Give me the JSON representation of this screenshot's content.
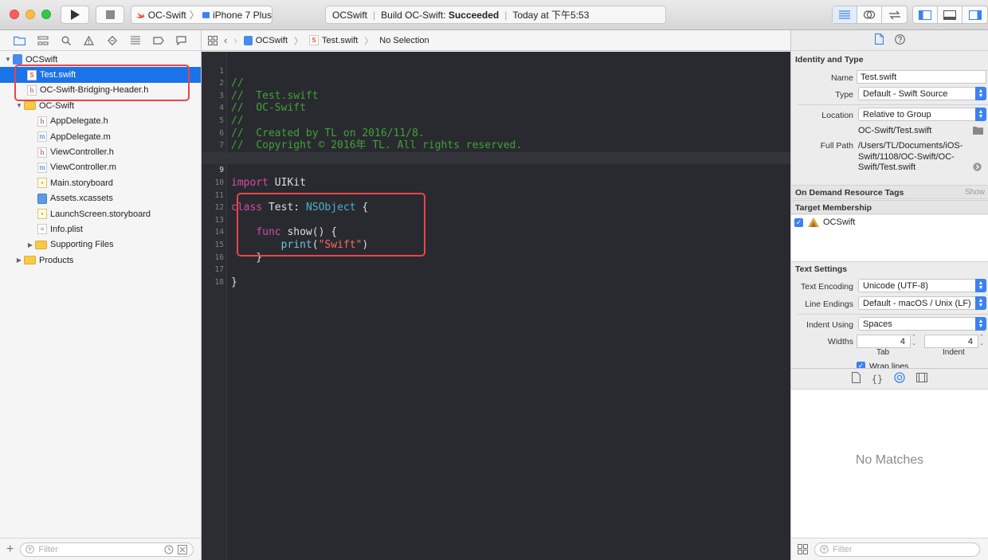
{
  "toolbar": {
    "scheme_target": "OC-Swift",
    "scheme_device": "iPhone 7 Plus",
    "activity_project": "OCSwift",
    "activity_build_prefix": "Build OC-Swift: ",
    "activity_build_status": "Succeeded",
    "activity_time": "Today at 下午5:53"
  },
  "navigator": {
    "items": [
      {
        "label": "OCSwift"
      },
      {
        "label": "Test.swift"
      },
      {
        "label": "OC-Swift-Bridging-Header.h"
      },
      {
        "label": "OC-Swift"
      },
      {
        "label": "AppDelegate.h"
      },
      {
        "label": "AppDelegate.m"
      },
      {
        "label": "ViewController.h"
      },
      {
        "label": "ViewController.m"
      },
      {
        "label": "Main.storyboard"
      },
      {
        "label": "Assets.xcassets"
      },
      {
        "label": "LaunchScreen.storyboard"
      },
      {
        "label": "Info.plist"
      },
      {
        "label": "Supporting Files"
      },
      {
        "label": "Products"
      }
    ],
    "filter_placeholder": "Filter"
  },
  "jumpbar": {
    "project": "OCSwift",
    "file": "Test.swift",
    "selection": "No Selection"
  },
  "editor": {
    "line_numbers": [
      "1",
      "2",
      "3",
      "4",
      "5",
      "6",
      "7",
      "8",
      "9",
      "10",
      "11",
      "12",
      "13",
      "14",
      "15",
      "16",
      "17",
      "18"
    ],
    "current_line": 9,
    "code": {
      "l1": "//",
      "l2": "//  Test.swift",
      "l3": "//  OC-Swift",
      "l4": "//",
      "l5": "//  Created by TL on 2016/11/8.",
      "l6": "//  Copyright © 2016年 TL. All rights reserved.",
      "l7": "//",
      "kw_import": "import",
      "mod_uikit": " UIKit",
      "kw_class": "class",
      "class_name": " Test: ",
      "superclass": "NSObject",
      "brace_open": " {",
      "indent1": "    ",
      "kw_func": "func",
      "func_sig": " show() {",
      "indent2": "        ",
      "fn_print": "print",
      "paren_open": "(",
      "str_swift": "\"Swift\"",
      "paren_close": ")",
      "close_func": "    }",
      "close_class": "}"
    }
  },
  "inspector": {
    "identity_title": "Identity and Type",
    "name_label": "Name",
    "name_value": "Test.swift",
    "type_label": "Type",
    "type_value": "Default - Swift Source",
    "location_label": "Location",
    "location_value": "Relative to Group",
    "location_path": "OC-Swift/Test.swift",
    "fullpath_label": "Full Path",
    "fullpath_l1": "/Users/TL/Documents/iOS-",
    "fullpath_l2": "Swift/1108/OC-Swift/OC-",
    "fullpath_l3": "Swift/Test.swift",
    "odr_title": "On Demand Resource Tags",
    "odr_show": "Show",
    "target_title": "Target Membership",
    "target_name": "OCSwift",
    "text_title": "Text Settings",
    "encoding_label": "Text Encoding",
    "encoding_value": "Unicode (UTF-8)",
    "endings_label": "Line Endings",
    "endings_value": "Default - macOS / Unix (LF)",
    "indent_label": "Indent Using",
    "indent_value": "Spaces",
    "widths_label": "Widths",
    "tab_value": "4",
    "indent_width_value": "4",
    "tab_caption": "Tab",
    "indent_caption": "Indent",
    "wrap_label": "Wrap lines",
    "no_matches": "No Matches",
    "filter_placeholder": "Filter"
  },
  "colors": {
    "selection": "#1a73e8",
    "editor_bg": "#292a30",
    "comment": "#41a138",
    "keyword": "#d54aa3",
    "type": "#4ab1c9",
    "string": "#fc6a5d",
    "annotation": "#e8454a"
  }
}
